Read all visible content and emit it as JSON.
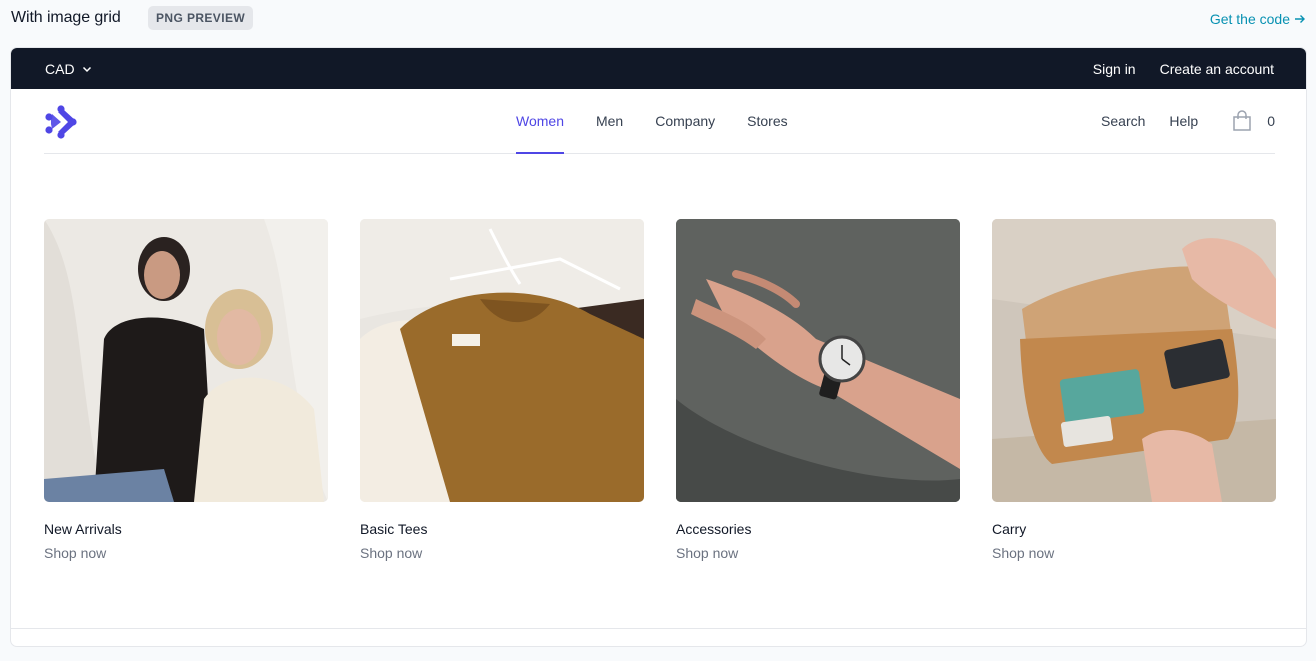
{
  "preview": {
    "title": "With image grid",
    "badge": "PNG PREVIEW",
    "get_code": "Get the code"
  },
  "topbar": {
    "currency": "CAD",
    "sign_in": "Sign in",
    "create_account": "Create an account"
  },
  "nav": {
    "items": [
      {
        "label": "Women"
      },
      {
        "label": "Men"
      },
      {
        "label": "Company"
      },
      {
        "label": "Stores"
      }
    ],
    "search": "Search",
    "help": "Help",
    "cart_count": "0"
  },
  "collections": [
    {
      "name": "New Arrivals",
      "cta": "Shop now"
    },
    {
      "name": "Basic Tees",
      "cta": "Shop now"
    },
    {
      "name": "Accessories",
      "cta": "Shop now"
    },
    {
      "name": "Carry",
      "cta": "Shop now"
    }
  ],
  "colors": {
    "accent": "#4f46e5",
    "topbar": "#111827",
    "link": "#0891b2"
  }
}
